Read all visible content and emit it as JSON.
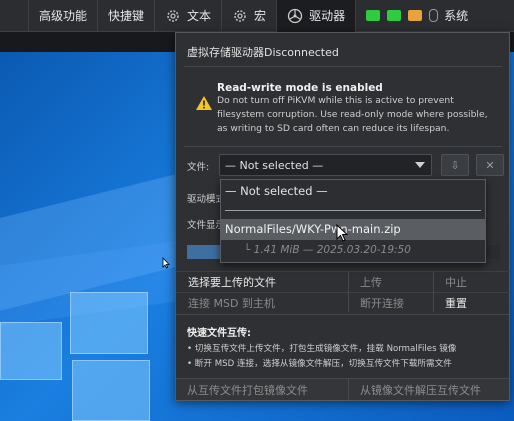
{
  "menu": {
    "advanced": "高级功能",
    "shortcuts": "快捷键",
    "text": "文本",
    "macro": "宏",
    "drive": "驱动器",
    "system": "系统"
  },
  "colors": {
    "status_green": "#2ecc40",
    "status_keyboard": "#e8a33c",
    "panel_bg": "#2e3033"
  },
  "panel": {
    "title": "虚拟存储驱动器Disconnected",
    "warning": {
      "title": "Read-write mode is enabled",
      "line1": "Do not turn off PiKVM while this is active to prevent",
      "line2": "filesystem corruption. Use read-only mode where possible,",
      "line3": "as writing to SD card often can reduce its lifespan."
    },
    "file_label": "文件:",
    "file_selected": "— Not selected —",
    "drive_mode_label": "驱动模式",
    "file_display_label": "文件显示",
    "buttons": {
      "select_upload": "选择要上传的文件",
      "upload": "上传",
      "abort": "中止",
      "connect_msd": "连接 MSD 到主机",
      "disconnect": "断开连接",
      "reset": "重置"
    },
    "howto": {
      "title": "快速文件互传:",
      "line1": "• 切换互传文件上传文件，打包生成镜像文件，挂载 NormalFiles 镜像",
      "line2": "• 断开 MSD 连接，选择从镜像文件解压，切换互传文件下载所需文件"
    },
    "bottom": {
      "pack": "从互传文件打包镜像文件",
      "unpack": "从镜像文件解压互传文件"
    }
  },
  "dropdown": {
    "options": [
      {
        "label": "— Not selected —"
      },
      {
        "label": "NormalFiles/WKY-Pwn-main.zip",
        "meta": "└ 1.41 MiB — 2025.03.20-19:50"
      }
    ]
  }
}
